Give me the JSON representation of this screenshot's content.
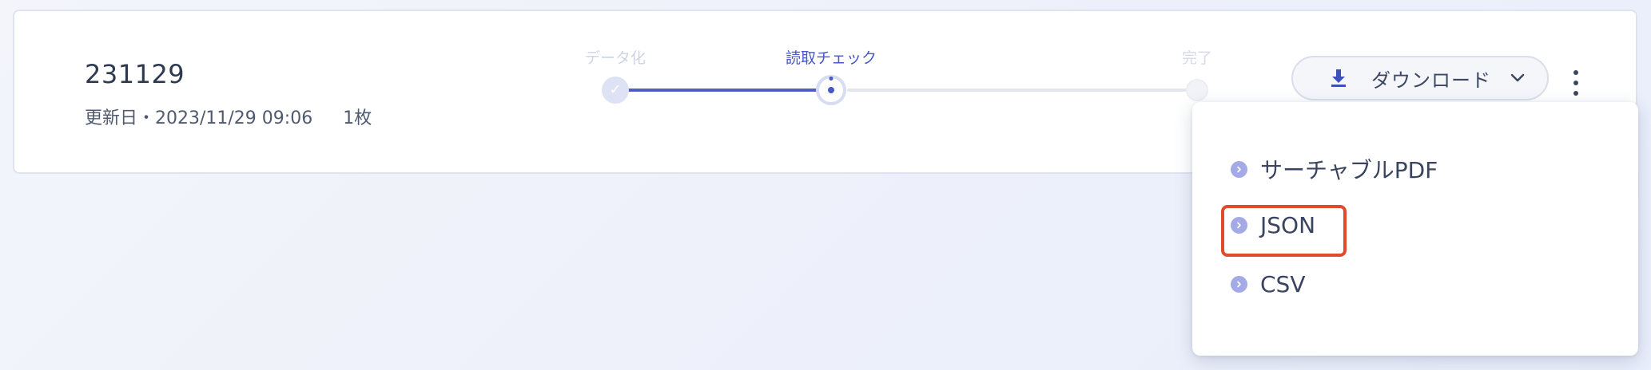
{
  "item": {
    "title": "231129",
    "updated": "更新日・2023/11/29 09:06",
    "page_count": "1枚"
  },
  "stepper": {
    "steps": [
      {
        "label": "データ化",
        "state": "done"
      },
      {
        "label": "読取チェック",
        "state": "current"
      },
      {
        "label": "完了",
        "state": "future"
      }
    ]
  },
  "download_button": {
    "label": "ダウンロード",
    "icon": "download-icon"
  },
  "more_menu": {
    "icon": "kebab-icon"
  },
  "download_menu": {
    "items": [
      {
        "label": "サーチャブルPDF"
      },
      {
        "label": "JSON"
      },
      {
        "label": "CSV"
      }
    ],
    "highlighted_index": 1,
    "highlight_color": "#e14a2b"
  },
  "colors": {
    "accent": "#4858c9",
    "bullet": "#a3aae6"
  }
}
